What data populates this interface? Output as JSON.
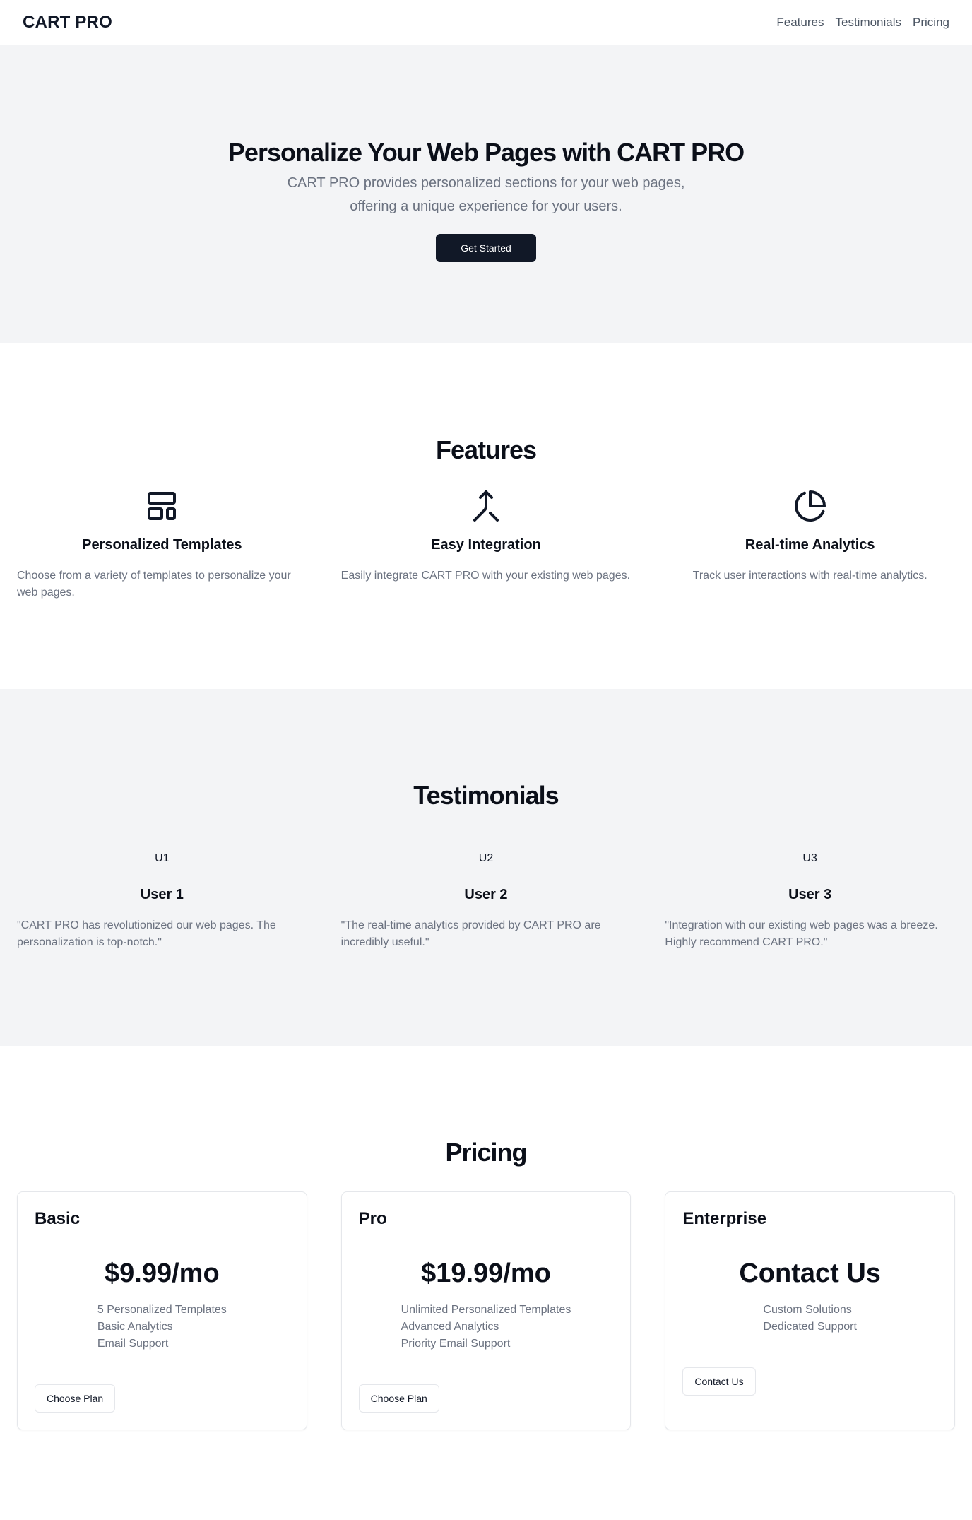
{
  "header": {
    "brand": "CART PRO",
    "nav": [
      "Features",
      "Testimonials",
      "Pricing"
    ]
  },
  "hero": {
    "title": "Personalize Your Web Pages with CART PRO",
    "subtitle": "CART PRO provides personalized sections for your web pages, offering a unique experience for your users.",
    "cta": "Get Started"
  },
  "features": {
    "title": "Features",
    "items": [
      {
        "icon": "layout-template-icon",
        "title": "Personalized Templates",
        "desc": "Choose from a variety of templates to personalize your web pages."
      },
      {
        "icon": "merge-arrow-icon",
        "title": "Easy Integration",
        "desc": "Easily integrate CART PRO with your existing web pages."
      },
      {
        "icon": "pie-chart-icon",
        "title": "Real-time Analytics",
        "desc": "Track user interactions with real-time analytics."
      }
    ]
  },
  "testimonials": {
    "title": "Testimonials",
    "items": [
      {
        "avatar": "U1",
        "name": "User 1",
        "quote": "\"CART PRO has revolutionized our web pages. The personalization is top-notch.\""
      },
      {
        "avatar": "U2",
        "name": "User 2",
        "quote": "\"The real-time analytics provided by CART PRO are incredibly useful.\""
      },
      {
        "avatar": "U3",
        "name": "User 3",
        "quote": "\"Integration with our existing web pages was a breeze. Highly recommend CART PRO.\""
      }
    ]
  },
  "pricing": {
    "title": "Pricing",
    "plans": [
      {
        "name": "Basic",
        "price": "$9.99/mo",
        "features": [
          "5 Personalized Templates",
          "Basic Analytics",
          "Email Support"
        ],
        "button": "Choose Plan"
      },
      {
        "name": "Pro",
        "price": "$19.99/mo",
        "features": [
          "Unlimited Personalized Templates",
          "Advanced Analytics",
          "Priority Email Support"
        ],
        "button": "Choose Plan"
      },
      {
        "name": "Enterprise",
        "price": "Contact Us",
        "features": [
          "Custom Solutions",
          "Dedicated Support"
        ],
        "button": "Contact Us"
      }
    ]
  },
  "colors": {
    "primary": "#111827",
    "muted_text": "#6b7280",
    "section_bg": "#f3f4f6",
    "border": "#e5e7eb"
  }
}
